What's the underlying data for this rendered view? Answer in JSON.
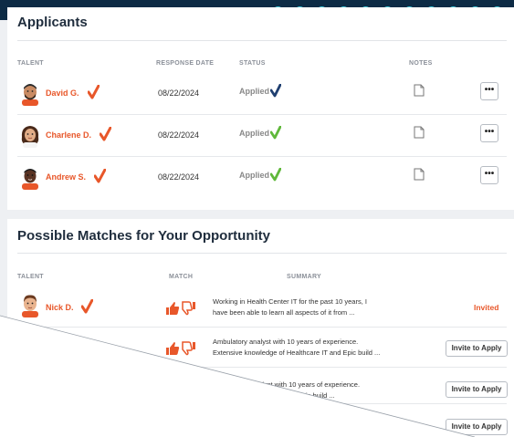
{
  "applicants": {
    "title": "Applicants",
    "columns": {
      "talent": "TALENT",
      "response_date": "RESPONSE DATE",
      "status": "STATUS",
      "notes": "NOTES"
    },
    "rows": [
      {
        "name": "David G.",
        "date": "08/22/2024",
        "status": "Applied",
        "status_check_color": "#1f3f70",
        "more_label": "•••"
      },
      {
        "name": "Charlene D.",
        "date": "08/22/2024",
        "status": "Applied",
        "status_check_color": "#5fb83a",
        "more_label": "•••"
      },
      {
        "name": "Andrew S.",
        "date": "08/22/2024",
        "status": "Applied",
        "status_check_color": "#5fb83a",
        "more_label": "•••"
      }
    ]
  },
  "matches": {
    "title": "Possible Matches for Your Opportunity",
    "columns": {
      "talent": "TALENT",
      "match": "MATCH",
      "summary": "SUMMARY"
    },
    "rows": [
      {
        "name": "Nick D.",
        "summary_line1": "Working in Health Center IT for the past 10 years, I",
        "summary_line2": "have been able to learn all aspects of it from ...",
        "action": "Invited"
      },
      {
        "summary_line1": "Ambulatory analyst with 10 years of experience.",
        "summary_line2": "Extensive knowledge of Healthcare IT and Epic build ...",
        "action": "Invite to Apply"
      },
      {
        "summary_line1": "nalyst with 10 years of experience.",
        "summary_line2": "lthcare IT and Epic build ...",
        "action": "Invite to Apply"
      },
      {
        "action": "Invite to Apply"
      }
    ]
  },
  "colors": {
    "accent": "#e8572a",
    "header_band": "#0d2b45",
    "dots": "#3ec7d9"
  }
}
